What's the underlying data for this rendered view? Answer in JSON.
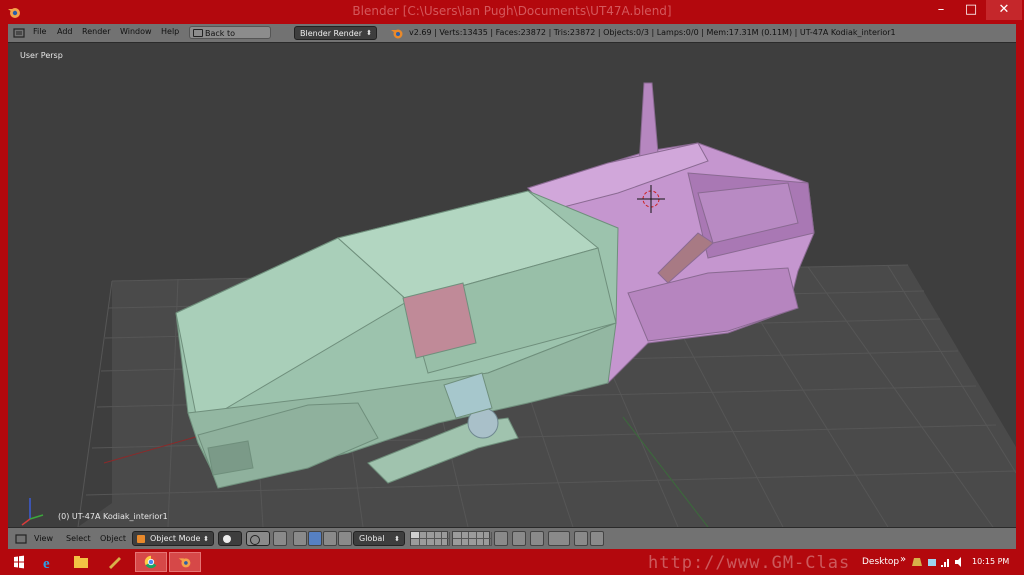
{
  "window": {
    "title": "Blender [C:\\Users\\Ian Pugh\\Documents\\UT47A.blend]",
    "controls": [
      "–",
      "□",
      "✕"
    ]
  },
  "info_header": {
    "menus": [
      "File",
      "Add",
      "Render",
      "Window",
      "Help"
    ],
    "back_button": "Back to Previous",
    "render_engine": "Blender Render",
    "stats": "v2.69 | Verts:13435 | Faces:23872 | Tris:23872 | Objects:0/3 | Lamps:0/0 | Mem:17.31M (0.11M) | UT-47A Kodiak_interior1"
  },
  "viewport": {
    "perspective_label": "User Persp",
    "object_label": "(0) UT-47A Kodiak_interior1",
    "colors": {
      "background": "#3e3e3e",
      "grid": "#595959",
      "mesh_green": "#9cc3ad",
      "mesh_purple": "#c596cf"
    }
  },
  "view_header": {
    "menus": [
      "View",
      "Select",
      "Object"
    ],
    "mode": "Object Mode",
    "orientation": "Global"
  },
  "taskbar": {
    "desktop_label": "Desktop",
    "time": "10:15 PM",
    "watermark": "http://www.GM-Clas"
  },
  "colors": {
    "window_frame": "#b3080d",
    "header": "#727272",
    "accent": "#5680c2"
  }
}
